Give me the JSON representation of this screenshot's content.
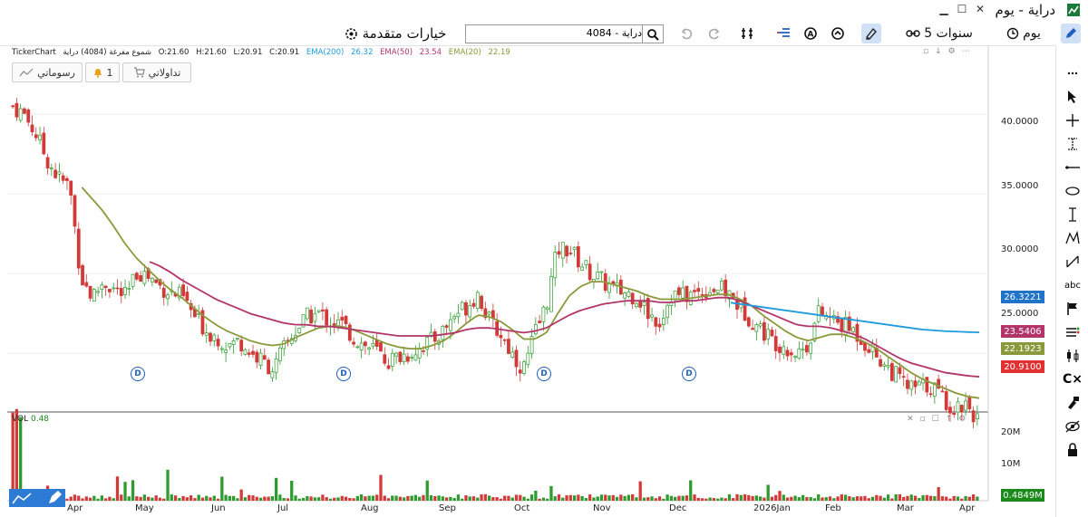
{
  "window": {
    "title": "دراية - يوم",
    "controls": [
      "▁",
      "☐",
      "✕"
    ]
  },
  "toolbar": {
    "period": "يوم",
    "range": "5 سنوات",
    "search_value": "4084 - دراية",
    "advanced_options": "خيارات متقدمة"
  },
  "info": {
    "provider": "TickerChart",
    "series_name": "شموع مفرغة (4084) دراية",
    "open": "O:21.60",
    "high": "H:21.60",
    "low": "L:20.91",
    "close": "C:20.91",
    "ema200_label": "EMA(200)",
    "ema200_value": "26.32",
    "ema50_label": "EMA(50)",
    "ema50_value": "23.54",
    "ema20_label": "EMA(20)",
    "ema20_value": "22.19"
  },
  "buttons": {
    "drawings": "رسوماتي",
    "alerts_count": "1",
    "trades": "تداولاتي"
  },
  "volume_pane": {
    "label": "VOL",
    "value": "0.48"
  },
  "price_axis": [
    "40.0000",
    "35.0000",
    "30.0000",
    "25.0000"
  ],
  "volume_axis": [
    "20M",
    "10M"
  ],
  "price_tags": [
    {
      "text": "26.3221",
      "color": "#1f74c9"
    },
    {
      "text": "23.5406",
      "color": "#b33468"
    },
    {
      "text": "22.1923",
      "color": "#8a9a3a"
    },
    {
      "text": "20.9100",
      "color": "#e03030"
    }
  ],
  "volume_tag": {
    "text": "0.4849M",
    "color": "#1a8a1a"
  },
  "x_labels": [
    "Apr",
    "May",
    "Jun",
    "Jul",
    "Aug",
    "Sep",
    "Oct",
    "Nov",
    "Dec",
    "2026Jan",
    "Feb",
    "Mar",
    "Apr"
  ],
  "dividend_marker": "D",
  "colors": {
    "up": "#2e9b2e",
    "down": "#d23a3a",
    "ema20": "#8a9a3a",
    "ema50": "#b33468",
    "ema200": "#1f9be0",
    "accent": "#1f5fbf"
  },
  "icons": [
    "pencil-icon",
    "clock-icon",
    "link-icon",
    "drawing-mode-icon",
    "gauge-icon",
    "alert-a-icon",
    "list-icon",
    "compare-icon",
    "redo-icon",
    "undo-icon",
    "search-icon",
    "settings-icon",
    "cursor-icon",
    "crosshair-icon",
    "measure-icon",
    "horizontal-line-icon",
    "ellipse-icon",
    "vertical-line-icon",
    "pattern-icon",
    "trend-icon",
    "text-icon",
    "flag-icon",
    "indicator-list-icon",
    "candles-icon",
    "clear-icon",
    "lock-draw-icon",
    "hide-icon",
    "lock-icon"
  ],
  "chart_data": {
    "type": "candlestick",
    "x_labels": [
      "Apr",
      "May",
      "Jun",
      "Jul",
      "Aug",
      "Sep",
      "Oct",
      "Nov",
      "Dec",
      "2026Jan",
      "Feb",
      "Mar",
      "Apr"
    ],
    "ylim": [
      21.5,
      43.3
    ],
    "y_ticks": [
      25,
      30,
      35,
      40
    ],
    "close_path": [
      40.5,
      40.0,
      38.8,
      37.2,
      36.0,
      35.5,
      29.8,
      28.5,
      29.5,
      29.0,
      28.5,
      30.2,
      29.8,
      29.2,
      28.8,
      28.5,
      27.3,
      26.5,
      26.0,
      25.5,
      25.8,
      25.0,
      24.5,
      24.0,
      25.5,
      26.5,
      27.3,
      27.5,
      27.0,
      26.8,
      26.0,
      25.5,
      25.2,
      24.5,
      24.8,
      25.0,
      25.5,
      25.8,
      26.5,
      27.5,
      28.0,
      28.8,
      27.0,
      26.2,
      25.0,
      24.0,
      26.2,
      28.0,
      31.5,
      31.6,
      30.7,
      30.0,
      29.5,
      29.0,
      28.8,
      28.6,
      27.5,
      27.0,
      28.7,
      28.6,
      28.7,
      29.0,
      29.1,
      28.8,
      28.0,
      27.2,
      26.5,
      25.8,
      25.5,
      25.0,
      25.5,
      27.5,
      27.2,
      26.8,
      26.5,
      25.8,
      25.0,
      24.2,
      23.5,
      22.8,
      22.9,
      23.0,
      22.2,
      21.5,
      22.0,
      20.9
    ],
    "ema20": [
      null,
      null,
      null,
      null,
      null,
      null,
      35.6,
      34.8,
      34.0,
      33.0,
      31.9,
      31.0,
      30.3,
      29.6,
      29.0,
      28.5,
      27.9,
      27.3,
      26.8,
      26.4,
      26.1,
      25.8,
      25.6,
      25.5,
      25.6,
      26.0,
      26.3,
      26.6,
      26.7,
      26.7,
      26.5,
      26.2,
      25.9,
      25.6,
      25.4,
      25.3,
      25.3,
      25.5,
      25.8,
      26.3,
      26.9,
      27.4,
      27.3,
      27.0,
      26.5,
      25.9,
      25.9,
      26.3,
      27.5,
      28.6,
      29.2,
      29.5,
      29.5,
      29.3,
      29.1,
      28.9,
      28.6,
      28.4,
      28.4,
      28.4,
      28.5,
      28.6,
      28.7,
      28.7,
      28.4,
      28.0,
      27.4,
      26.9,
      26.4,
      26.0,
      25.8,
      26.0,
      26.2,
      26.2,
      26.0,
      25.7,
      25.3,
      24.8,
      24.3,
      23.8,
      23.4,
      23.1,
      22.8,
      22.5,
      22.3,
      22.2
    ],
    "ema50": [
      null,
      null,
      null,
      null,
      null,
      null,
      null,
      null,
      null,
      null,
      null,
      null,
      30.8,
      30.5,
      30.1,
      29.6,
      29.2,
      28.8,
      28.4,
      28.1,
      27.8,
      27.5,
      27.3,
      27.1,
      26.9,
      26.8,
      26.8,
      26.7,
      26.7,
      26.6,
      26.5,
      26.4,
      26.3,
      26.2,
      26.1,
      26.1,
      26.1,
      26.1,
      26.2,
      26.3,
      26.5,
      26.6,
      26.6,
      26.5,
      26.4,
      26.3,
      26.4,
      26.6,
      27.0,
      27.4,
      27.7,
      27.9,
      28.1,
      28.2,
      28.3,
      28.3,
      28.3,
      28.2,
      28.2,
      28.3,
      28.3,
      28.4,
      28.5,
      28.5,
      28.3,
      28.0,
      27.7,
      27.4,
      27.1,
      26.8,
      26.7,
      26.7,
      26.6,
      26.4,
      26.2,
      25.9,
      25.5,
      25.1,
      24.7,
      24.4,
      24.2,
      24.0,
      23.8,
      23.7,
      23.6,
      23.54
    ],
    "ema200": [
      null,
      null,
      null,
      null,
      null,
      null,
      null,
      null,
      null,
      null,
      null,
      null,
      null,
      null,
      null,
      null,
      null,
      null,
      null,
      null,
      null,
      null,
      null,
      null,
      null,
      null,
      null,
      null,
      null,
      null,
      null,
      null,
      null,
      null,
      null,
      null,
      null,
      null,
      null,
      null,
      null,
      null,
      null,
      null,
      null,
      null,
      null,
      null,
      null,
      null,
      null,
      null,
      null,
      null,
      null,
      null,
      null,
      null,
      null,
      null,
      null,
      null,
      null,
      28.2,
      28.1,
      28.0,
      27.9,
      27.8,
      27.7,
      27.6,
      27.5,
      27.4,
      27.3,
      27.2,
      27.1,
      27.0,
      26.9,
      26.8,
      26.7,
      26.6,
      26.5,
      26.45,
      26.4,
      26.37,
      26.34,
      26.32
    ]
  }
}
